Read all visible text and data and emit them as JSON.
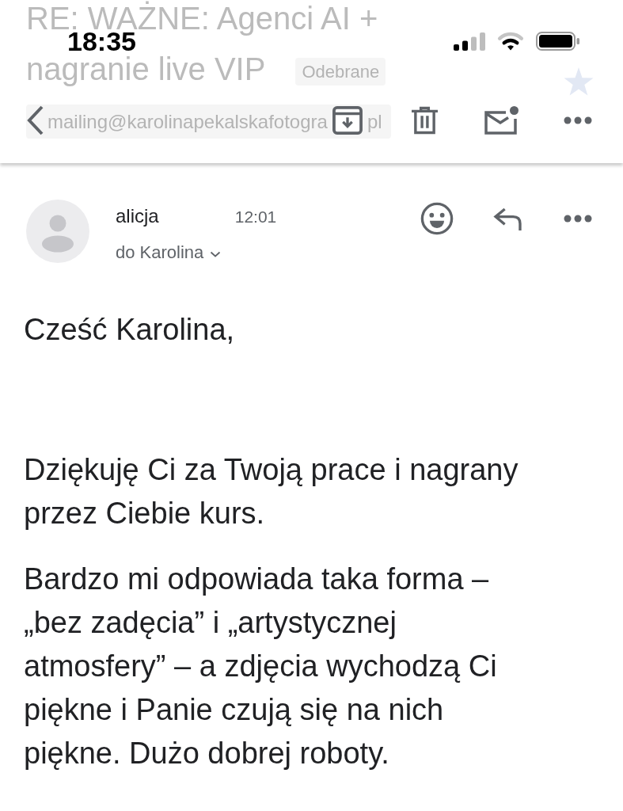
{
  "status_bar": {
    "time": "18:35"
  },
  "faded_header": {
    "subject_lines": [
      "RE: WAŻNE: Agenci AI +",
      "nagranie live VIP"
    ],
    "label": "Odebrane",
    "address_parts": [
      "mailing@karolinapekalskafotogra",
      "pl"
    ]
  },
  "message": {
    "sender": "alicja",
    "time": "12:01",
    "recipients": "do Karolina"
  },
  "body": {
    "greeting": "Cześć Karolina,",
    "paragraphs": [
      "Dziękuję Ci za Twoją prace i nagrany przez Ciebie kurs.",
      "Bardzo mi odpowiada taka forma – „bez zadęcia” i „artystycznej atmosfery” – a zdjęcia wychodzą Ci piękne i Panie czują się na nich piękne. Dużo dobrej roboty."
    ]
  }
}
